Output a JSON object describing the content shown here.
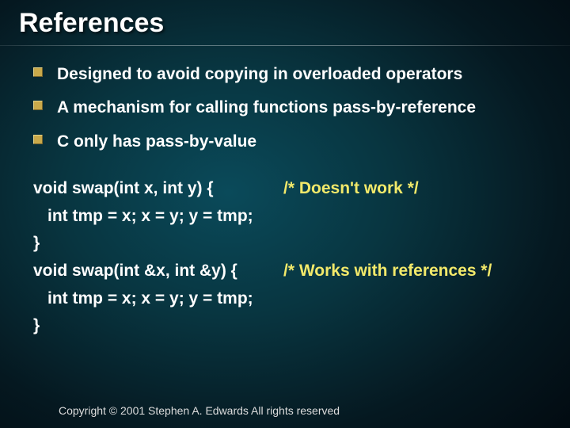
{
  "title": "References",
  "bullets": [
    "Designed to avoid copying in overloaded operators",
    "A mechanism for calling functions pass-by-reference",
    "C only has pass-by-value"
  ],
  "code": {
    "line1_sig": "void swap(int x, int y) {",
    "line1_comment": "/* Doesn't work */",
    "line2_body": "int tmp = x; x = y; y = tmp;",
    "line3_close": "}",
    "line4_sig": "void swap(int &x, int &y) {",
    "line4_comment": "/* Works with references */",
    "line5_body": "int tmp = x; x = y; y = tmp;",
    "line6_close": "}"
  },
  "footer": "Copyright © 2001 Stephen A. Edwards  All rights reserved"
}
